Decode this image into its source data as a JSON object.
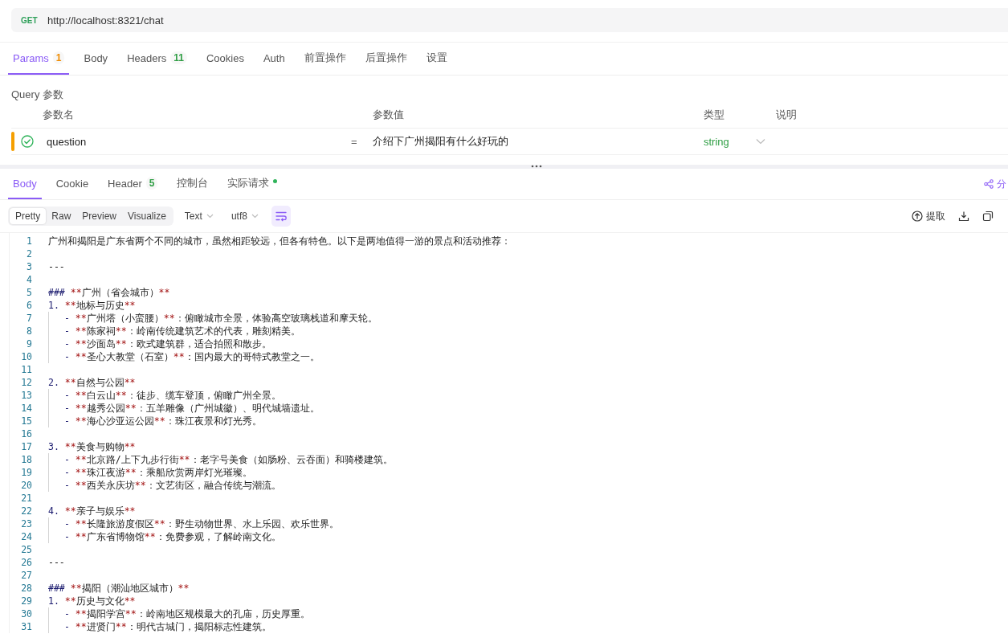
{
  "request": {
    "method": "GET",
    "url": "http://localhost:8321/chat"
  },
  "request_tabs": [
    {
      "label": "Params",
      "selected": true,
      "badge": {
        "text": "1",
        "color": "#f08c00"
      }
    },
    {
      "label": "Body",
      "selected": false
    },
    {
      "label": "Headers",
      "selected": false,
      "badge": {
        "text": "11",
        "color": "#2f9e44"
      }
    },
    {
      "label": "Cookies",
      "selected": false
    },
    {
      "label": "Auth",
      "selected": false
    },
    {
      "label": "前置操作",
      "selected": false
    },
    {
      "label": "后置操作",
      "selected": false
    },
    {
      "label": "设置",
      "selected": false
    }
  ],
  "query": {
    "title": "Query 参数",
    "columns": [
      "参数名",
      "参数值",
      "类型",
      "说明"
    ],
    "rows": [
      {
        "highlighted": true,
        "enabled": true,
        "name": "question",
        "operator": "=",
        "value": "介绍下广州揭阳有什么好玩的",
        "type": "string"
      }
    ]
  },
  "response_tabs": [
    {
      "label": "Body",
      "selected": true
    },
    {
      "label": "Cookie",
      "selected": false
    },
    {
      "label": "Header",
      "selected": false,
      "badge": {
        "text": "5",
        "color": "#2f9e44"
      }
    },
    {
      "label": "控制台",
      "selected": false
    },
    {
      "label": "实际请求",
      "selected": false,
      "dot": {
        "color": "#2fb35a"
      }
    }
  ],
  "share_label": "分",
  "formats": [
    {
      "label": "Pretty",
      "selected": true
    },
    {
      "label": "Raw",
      "selected": false
    },
    {
      "label": "Preview",
      "selected": false
    },
    {
      "label": "Visualize",
      "selected": false
    }
  ],
  "dropdowns": [
    "Text",
    "utf8"
  ],
  "wrap": {
    "on": true
  },
  "extract_label": "提取",
  "code_lines": [
    {
      "n": "1",
      "segs": [
        {
          "kind": "text",
          "text": "广州和揭阳是广东省两个不同的城市，虽然相距较远，但各有特色。以下是两地值得一游的景点和活动推荐："
        }
      ]
    },
    {
      "n": "2"
    },
    {
      "n": "3",
      "segs": [
        {
          "kind": "text",
          "text": "---"
        }
      ]
    },
    {
      "n": "4"
    },
    {
      "n": "5",
      "segs": [
        {
          "kind": "marker",
          "text": "### "
        },
        {
          "kind": "strong",
          "text": "**"
        },
        {
          "kind": "text",
          "text": "广州（省会城市）"
        },
        {
          "kind": "strong",
          "text": "**"
        }
      ]
    },
    {
      "n": "6",
      "segs": [
        {
          "kind": "marker",
          "text": "1. "
        },
        {
          "kind": "strong",
          "text": "**"
        },
        {
          "kind": "text",
          "text": "地标与历史"
        },
        {
          "kind": "strong",
          "text": "**"
        }
      ]
    },
    {
      "n": "7",
      "guide": true,
      "segs": [
        {
          "kind": "marker",
          "text": "- "
        },
        {
          "kind": "strong",
          "text": "**"
        },
        {
          "kind": "text",
          "text": "广州塔（小蛮腰）"
        },
        {
          "kind": "strong",
          "text": "**"
        },
        {
          "kind": "text",
          "text": "：俯瞰城市全景，体验高空玻璃栈道和摩天轮。"
        }
      ]
    },
    {
      "n": "8",
      "guide": true,
      "segs": [
        {
          "kind": "marker",
          "text": "- "
        },
        {
          "kind": "strong",
          "text": "**"
        },
        {
          "kind": "text",
          "text": "陈家祠"
        },
        {
          "kind": "strong",
          "text": "**"
        },
        {
          "kind": "text",
          "text": "：岭南传统建筑艺术的代表，雕刻精美。"
        }
      ]
    },
    {
      "n": "9",
      "guide": true,
      "segs": [
        {
          "kind": "marker",
          "text": "- "
        },
        {
          "kind": "strong",
          "text": "**"
        },
        {
          "kind": "text",
          "text": "沙面岛"
        },
        {
          "kind": "strong",
          "text": "**"
        },
        {
          "kind": "text",
          "text": "：欧式建筑群，适合拍照和散步。"
        }
      ]
    },
    {
      "n": "10",
      "guide": true,
      "segs": [
        {
          "kind": "marker",
          "text": "- "
        },
        {
          "kind": "strong",
          "text": "**"
        },
        {
          "kind": "text",
          "text": "圣心大教堂（石室）"
        },
        {
          "kind": "strong",
          "text": "**"
        },
        {
          "kind": "text",
          "text": "：国内最大的哥特式教堂之一。"
        }
      ]
    },
    {
      "n": "11"
    },
    {
      "n": "12",
      "segs": [
        {
          "kind": "marker",
          "text": "2. "
        },
        {
          "kind": "strong",
          "text": "**"
        },
        {
          "kind": "text",
          "text": "自然与公园"
        },
        {
          "kind": "strong",
          "text": "**"
        }
      ]
    },
    {
      "n": "13",
      "guide": true,
      "segs": [
        {
          "kind": "marker",
          "text": "- "
        },
        {
          "kind": "strong",
          "text": "**"
        },
        {
          "kind": "text",
          "text": "白云山"
        },
        {
          "kind": "strong",
          "text": "**"
        },
        {
          "kind": "text",
          "text": "：徒步、缆车登顶，俯瞰广州全景。"
        }
      ]
    },
    {
      "n": "14",
      "guide": true,
      "segs": [
        {
          "kind": "marker",
          "text": "- "
        },
        {
          "kind": "strong",
          "text": "**"
        },
        {
          "kind": "text",
          "text": "越秀公园"
        },
        {
          "kind": "strong",
          "text": "**"
        },
        {
          "kind": "text",
          "text": "：五羊雕像（广州城徽）、明代城墙遗址。"
        }
      ]
    },
    {
      "n": "15",
      "guide": true,
      "segs": [
        {
          "kind": "marker",
          "text": "- "
        },
        {
          "kind": "strong",
          "text": "**"
        },
        {
          "kind": "text",
          "text": "海心沙亚运公园"
        },
        {
          "kind": "strong",
          "text": "**"
        },
        {
          "kind": "text",
          "text": "：珠江夜景和灯光秀。"
        }
      ]
    },
    {
      "n": "16"
    },
    {
      "n": "17",
      "segs": [
        {
          "kind": "marker",
          "text": "3. "
        },
        {
          "kind": "strong",
          "text": "**"
        },
        {
          "kind": "text",
          "text": "美食与购物"
        },
        {
          "kind": "strong",
          "text": "**"
        }
      ]
    },
    {
      "n": "18",
      "guide": true,
      "segs": [
        {
          "kind": "marker",
          "text": "- "
        },
        {
          "kind": "strong",
          "text": "**"
        },
        {
          "kind": "text",
          "text": "北京路/上下九步行街"
        },
        {
          "kind": "strong",
          "text": "**"
        },
        {
          "kind": "text",
          "text": "：老字号美食（如肠粉、云吞面）和骑楼建筑。"
        }
      ]
    },
    {
      "n": "19",
      "guide": true,
      "segs": [
        {
          "kind": "marker",
          "text": "- "
        },
        {
          "kind": "strong",
          "text": "**"
        },
        {
          "kind": "text",
          "text": "珠江夜游"
        },
        {
          "kind": "strong",
          "text": "**"
        },
        {
          "kind": "text",
          "text": "：乘船欣赏两岸灯光璀璨。"
        }
      ]
    },
    {
      "n": "20",
      "guide": true,
      "segs": [
        {
          "kind": "marker",
          "text": "- "
        },
        {
          "kind": "strong",
          "text": "**"
        },
        {
          "kind": "text",
          "text": "西关永庆坊"
        },
        {
          "kind": "strong",
          "text": "**"
        },
        {
          "kind": "text",
          "text": "：文艺街区，融合传统与潮流。"
        }
      ]
    },
    {
      "n": "21"
    },
    {
      "n": "22",
      "segs": [
        {
          "kind": "marker",
          "text": "4. "
        },
        {
          "kind": "strong",
          "text": "**"
        },
        {
          "kind": "text",
          "text": "亲子与娱乐"
        },
        {
          "kind": "strong",
          "text": "**"
        }
      ]
    },
    {
      "n": "23",
      "guide": true,
      "segs": [
        {
          "kind": "marker",
          "text": "- "
        },
        {
          "kind": "strong",
          "text": "**"
        },
        {
          "kind": "text",
          "text": "长隆旅游度假区"
        },
        {
          "kind": "strong",
          "text": "**"
        },
        {
          "kind": "text",
          "text": "：野生动物世界、水上乐园、欢乐世界。"
        }
      ]
    },
    {
      "n": "24",
      "guide": true,
      "segs": [
        {
          "kind": "marker",
          "text": "- "
        },
        {
          "kind": "strong",
          "text": "**"
        },
        {
          "kind": "text",
          "text": "广东省博物馆"
        },
        {
          "kind": "strong",
          "text": "**"
        },
        {
          "kind": "text",
          "text": "：免费参观，了解岭南文化。"
        }
      ]
    },
    {
      "n": "25"
    },
    {
      "n": "26",
      "segs": [
        {
          "kind": "text",
          "text": "---"
        }
      ]
    },
    {
      "n": "27"
    },
    {
      "n": "28",
      "segs": [
        {
          "kind": "marker",
          "text": "### "
        },
        {
          "kind": "strong",
          "text": "**"
        },
        {
          "kind": "text",
          "text": "揭阳（潮汕地区城市）"
        },
        {
          "kind": "strong",
          "text": "**"
        }
      ]
    },
    {
      "n": "29",
      "segs": [
        {
          "kind": "marker",
          "text": "1. "
        },
        {
          "kind": "strong",
          "text": "**"
        },
        {
          "kind": "text",
          "text": "历史与文化"
        },
        {
          "kind": "strong",
          "text": "**"
        }
      ]
    },
    {
      "n": "30",
      "guide": true,
      "segs": [
        {
          "kind": "marker",
          "text": "- "
        },
        {
          "kind": "strong",
          "text": "**"
        },
        {
          "kind": "text",
          "text": "揭阳学宫"
        },
        {
          "kind": "strong",
          "text": "**"
        },
        {
          "kind": "text",
          "text": "：岭南地区规模最大的孔庙，历史厚重。"
        }
      ]
    },
    {
      "n": "31",
      "guide": true,
      "segs": [
        {
          "kind": "marker",
          "text": "- "
        },
        {
          "kind": "strong",
          "text": "**"
        },
        {
          "kind": "text",
          "text": "进贤门"
        },
        {
          "kind": "strong",
          "text": "**"
        },
        {
          "kind": "text",
          "text": "：明代古城门，揭阳标志性建筑。"
        }
      ]
    }
  ]
}
